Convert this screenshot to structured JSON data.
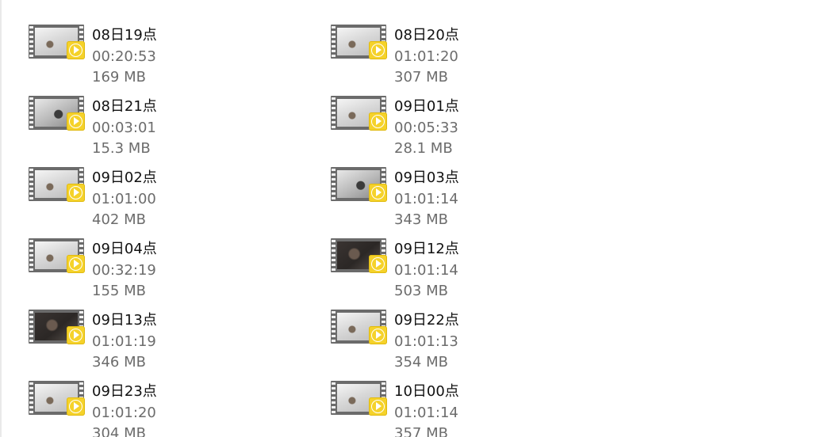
{
  "files": [
    {
      "name": "08日19点",
      "duration": "00:20:53",
      "size": "169 MB",
      "thumb": "light"
    },
    {
      "name": "08日20点",
      "duration": "01:01:20",
      "size": "307 MB",
      "thumb": "light"
    },
    {
      "name": "08日21点",
      "duration": "00:03:01",
      "size": "15.3 MB",
      "thumb": "mid"
    },
    {
      "name": "09日01点",
      "duration": "00:05:33",
      "size": "28.1 MB",
      "thumb": "light"
    },
    {
      "name": "09日02点",
      "duration": "01:01:00",
      "size": "402 MB",
      "thumb": "light"
    },
    {
      "name": "09日03点",
      "duration": "01:01:14",
      "size": "343 MB",
      "thumb": "mid"
    },
    {
      "name": "09日04点",
      "duration": "00:32:19",
      "size": "155 MB",
      "thumb": "light"
    },
    {
      "name": "09日12点",
      "duration": "01:01:14",
      "size": "503 MB",
      "thumb": "dark"
    },
    {
      "name": "09日13点",
      "duration": "01:01:19",
      "size": "346 MB",
      "thumb": "dark"
    },
    {
      "name": "09日22点",
      "duration": "01:01:13",
      "size": "354 MB",
      "thumb": "light"
    },
    {
      "name": "09日23点",
      "duration": "01:01:20",
      "size": "304 MB",
      "thumb": "light"
    },
    {
      "name": "10日00点",
      "duration": "01:01:14",
      "size": "357 MB",
      "thumb": "light"
    }
  ],
  "icons": {
    "file_type": "video-file-icon",
    "badge": "play-icon"
  },
  "colors": {
    "badge": "#f5d22a",
    "title_text": "#111111",
    "meta_text": "#6c6c6c"
  }
}
